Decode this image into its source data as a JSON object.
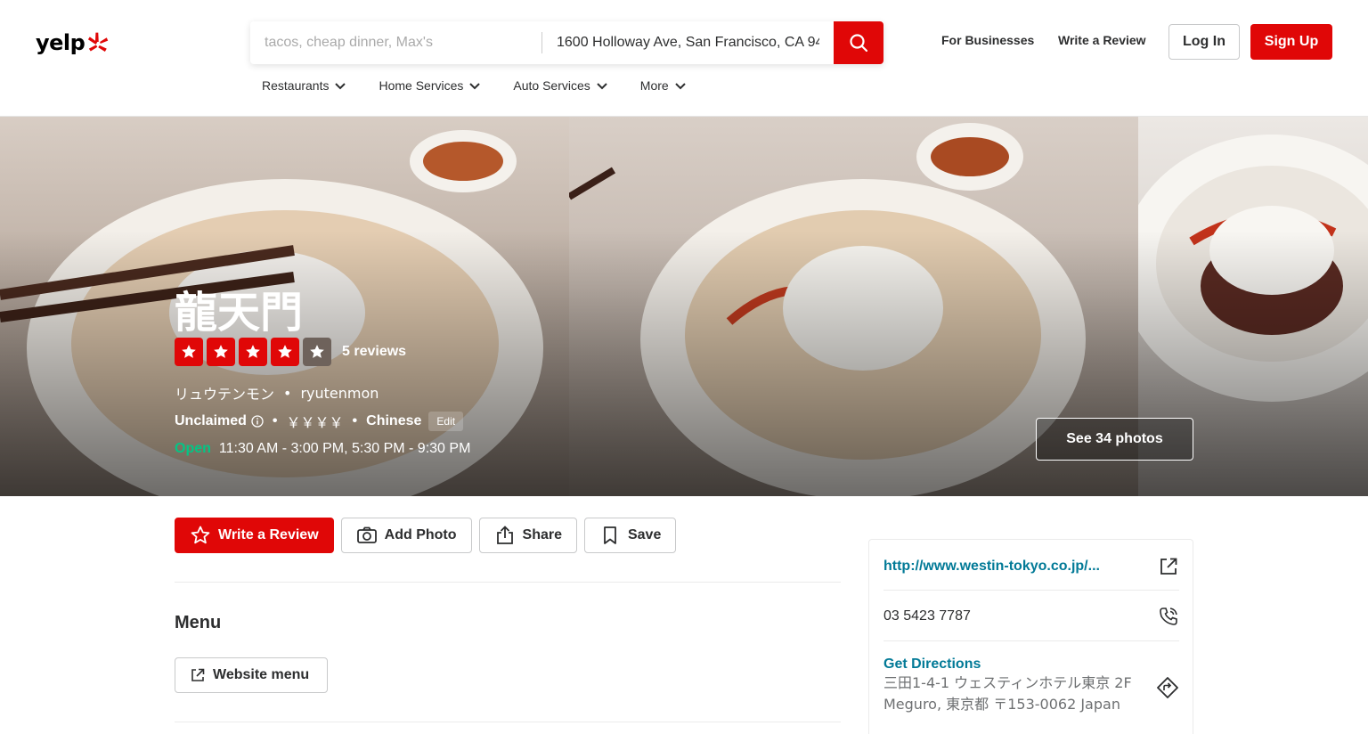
{
  "colors": {
    "brand_red": "#e00707",
    "open_green": "#04c585",
    "link_teal": "#027a97",
    "star_empty": "#6e625b"
  },
  "header": {
    "logo_text": "yelp",
    "search_what_placeholder": "tacos, cheap dinner, Max's",
    "search_where_value": "1600 Holloway Ave, San Francisco, CA 94",
    "for_businesses": "For Businesses",
    "write_review": "Write a Review",
    "login": "Log In",
    "signup": "Sign Up",
    "categories": [
      {
        "label": "Restaurants"
      },
      {
        "label": "Home Services"
      },
      {
        "label": "Auto Services"
      },
      {
        "label": "More"
      }
    ]
  },
  "business": {
    "name": "龍天門",
    "rating": 4,
    "rating_max": 5,
    "review_count": "5 reviews",
    "alt_name_kana": "リュウテンモン",
    "alt_name_roman": "ryutenmon",
    "claim_status": "Unclaimed",
    "price": "￥￥￥￥",
    "category": "Chinese",
    "edit": "Edit",
    "open_status": "Open",
    "hours": "11:30 AM - 3:00 PM, 5:30 PM - 9:30 PM",
    "see_photos": "See 34 photos"
  },
  "actions": {
    "write_review": "Write a Review",
    "add_photo": "Add Photo",
    "share": "Share",
    "save": "Save"
  },
  "menu": {
    "title": "Menu",
    "website_menu": "Website menu"
  },
  "sidebar": {
    "website": "http://www.westin-tokyo.co.jp/...",
    "phone": "03 5423 7787",
    "directions": "Get Directions",
    "address_line1": "三田1-4-1 ウェスティンホテル東京 2F",
    "address_line2": "Meguro, 東京都 〒153-0062 Japan"
  }
}
